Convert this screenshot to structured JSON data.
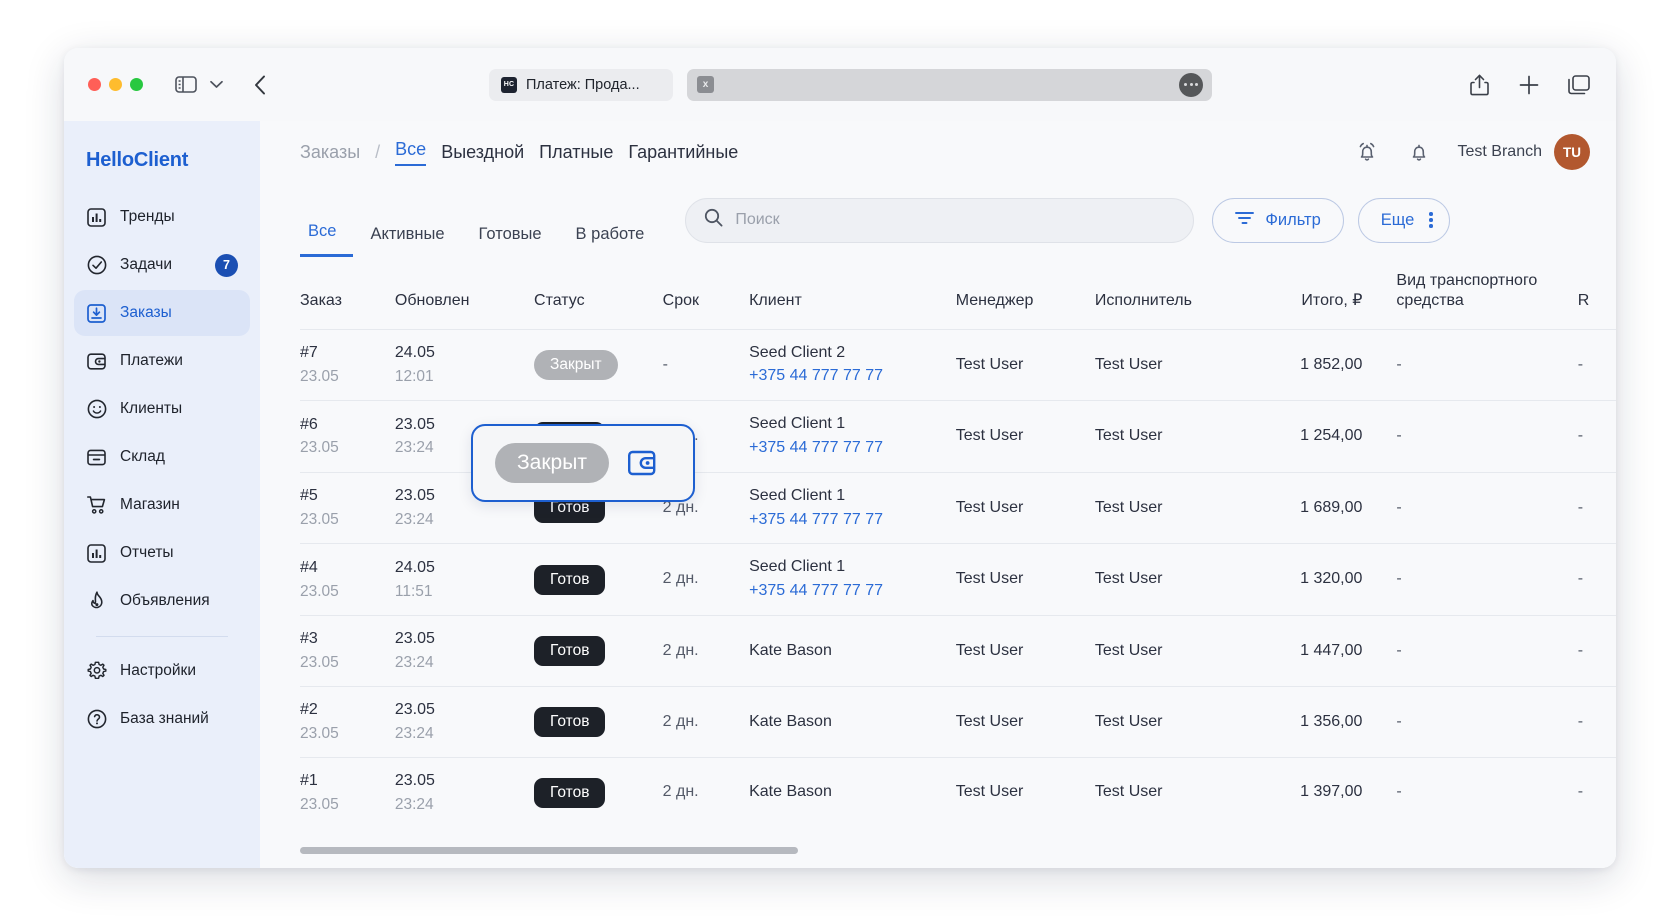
{
  "browser": {
    "tab": {
      "favicon_text": "HC",
      "title": "Платеж: Прода..."
    },
    "address_bar": {
      "value": "",
      "close_label": "x"
    },
    "icons": {
      "sidebar_toggle": "sidebar-toggle-icon",
      "chevron": "chevron-down-icon",
      "back": "back-arrow-icon",
      "more": "more-dots-icon",
      "share": "share-icon",
      "new_tab": "plus-icon",
      "tabs_overview": "tabs-overview-icon"
    }
  },
  "sidebar": {
    "brand": "HelloClient",
    "items": [
      {
        "label": "Тренды",
        "icon": "chart-bar-icon",
        "active": false,
        "badge": ""
      },
      {
        "label": "Задачи",
        "icon": "check-circle-icon",
        "active": false,
        "badge": "7"
      },
      {
        "label": "Заказы",
        "icon": "inbox-down-icon",
        "active": true,
        "badge": ""
      },
      {
        "label": "Платежи",
        "icon": "wallet-icon",
        "active": false,
        "badge": ""
      },
      {
        "label": "Клиенты",
        "icon": "smiley-icon",
        "active": false,
        "badge": ""
      },
      {
        "label": "Склад",
        "icon": "box-icon",
        "active": false,
        "badge": ""
      },
      {
        "label": "Магазин",
        "icon": "cart-icon",
        "active": false,
        "badge": ""
      },
      {
        "label": "Отчеты",
        "icon": "chart-bar-icon",
        "active": false,
        "badge": ""
      },
      {
        "label": "Объявления",
        "icon": "flame-icon",
        "active": false,
        "badge": ""
      }
    ],
    "footer_items": [
      {
        "label": "Настройки",
        "icon": "gear-icon"
      },
      {
        "label": "База знаний",
        "icon": "question-circle-icon"
      }
    ]
  },
  "topbar": {
    "breadcrumb_root": "Заказы",
    "breadcrumb_separator": "/",
    "breadcrumb_links": [
      {
        "label": "Все",
        "active": true
      },
      {
        "label": "Выездной",
        "active": false
      },
      {
        "label": "Платные",
        "active": false
      },
      {
        "label": "Гарантийные",
        "active": false
      }
    ],
    "branch": "Test Branch",
    "avatar_initials": "TU",
    "avatar_color": "#b2582f"
  },
  "filterbar": {
    "tabs": [
      {
        "label": "Все",
        "active": true
      },
      {
        "label": "Активные",
        "active": false
      },
      {
        "label": "Готовые",
        "active": false
      },
      {
        "label": "В работе",
        "active": false
      }
    ],
    "search": {
      "placeholder": "Поиск",
      "value": ""
    },
    "filter_button": "Фильтр",
    "more_button": "Еще"
  },
  "table": {
    "headers": [
      "Заказ",
      "Обновлен",
      "Статус",
      "Срок",
      "Клиент",
      "Менеджер",
      "Исполнитель",
      "Итого, ₽",
      "Вид транспортного средства",
      "R"
    ],
    "rows": [
      {
        "order": "#7",
        "order_date": "23.05",
        "updated": "24.05",
        "updated_time": "12:01",
        "status": "Закрыт",
        "status_kind": "closed",
        "term": "-",
        "client": "Seed Client 2",
        "phone": "+375 44 777 77 77",
        "manager": "Test User",
        "executor": "Test User",
        "total": "1 852,00",
        "vehicle": "-",
        "r": "-"
      },
      {
        "order": "#6",
        "order_date": "23.05",
        "updated": "23.05",
        "updated_time": "23:24",
        "status": "Готов",
        "status_kind": "ready",
        "term": "2 дн.",
        "client": "Seed Client 1",
        "phone": "+375 44 777 77 77",
        "manager": "Test User",
        "executor": "Test User",
        "total": "1 254,00",
        "vehicle": "-",
        "r": "-"
      },
      {
        "order": "#5",
        "order_date": "23.05",
        "updated": "23.05",
        "updated_time": "23:24",
        "status": "Готов",
        "status_kind": "ready",
        "term": "2 дн.",
        "client": "Seed Client 1",
        "phone": "+375 44 777 77 77",
        "manager": "Test User",
        "executor": "Test User",
        "total": "1 689,00",
        "vehicle": "-",
        "r": "-"
      },
      {
        "order": "#4",
        "order_date": "23.05",
        "updated": "24.05",
        "updated_time": "11:51",
        "status": "Готов",
        "status_kind": "ready",
        "term": "2 дн.",
        "client": "Seed Client 1",
        "phone": "+375 44 777 77 77",
        "manager": "Test User",
        "executor": "Test User",
        "total": "1 320,00",
        "vehicle": "-",
        "r": "-"
      },
      {
        "order": "#3",
        "order_date": "23.05",
        "updated": "23.05",
        "updated_time": "23:24",
        "status": "Готов",
        "status_kind": "ready",
        "term": "2 дн.",
        "client": "Kate Bason",
        "phone": "",
        "manager": "Test User",
        "executor": "Test User",
        "total": "1 447,00",
        "vehicle": "-",
        "r": "-"
      },
      {
        "order": "#2",
        "order_date": "23.05",
        "updated": "23.05",
        "updated_time": "23:24",
        "status": "Готов",
        "status_kind": "ready",
        "term": "2 дн.",
        "client": "Kate Bason",
        "phone": "",
        "manager": "Test User",
        "executor": "Test User",
        "total": "1 356,00",
        "vehicle": "-",
        "r": "-"
      },
      {
        "order": "#1",
        "order_date": "23.05",
        "updated": "23.05",
        "updated_time": "23:24",
        "status": "Готов",
        "status_kind": "ready",
        "term": "2 дн.",
        "client": "Kate Bason",
        "phone": "",
        "manager": "Test User",
        "executor": "Test User",
        "total": "1 397,00",
        "vehicle": "-",
        "r": "-"
      }
    ]
  },
  "highlight_popup": {
    "chip_label": "Закрыт",
    "icon": "wallet-icon",
    "border_color": "#1d5fd0"
  }
}
